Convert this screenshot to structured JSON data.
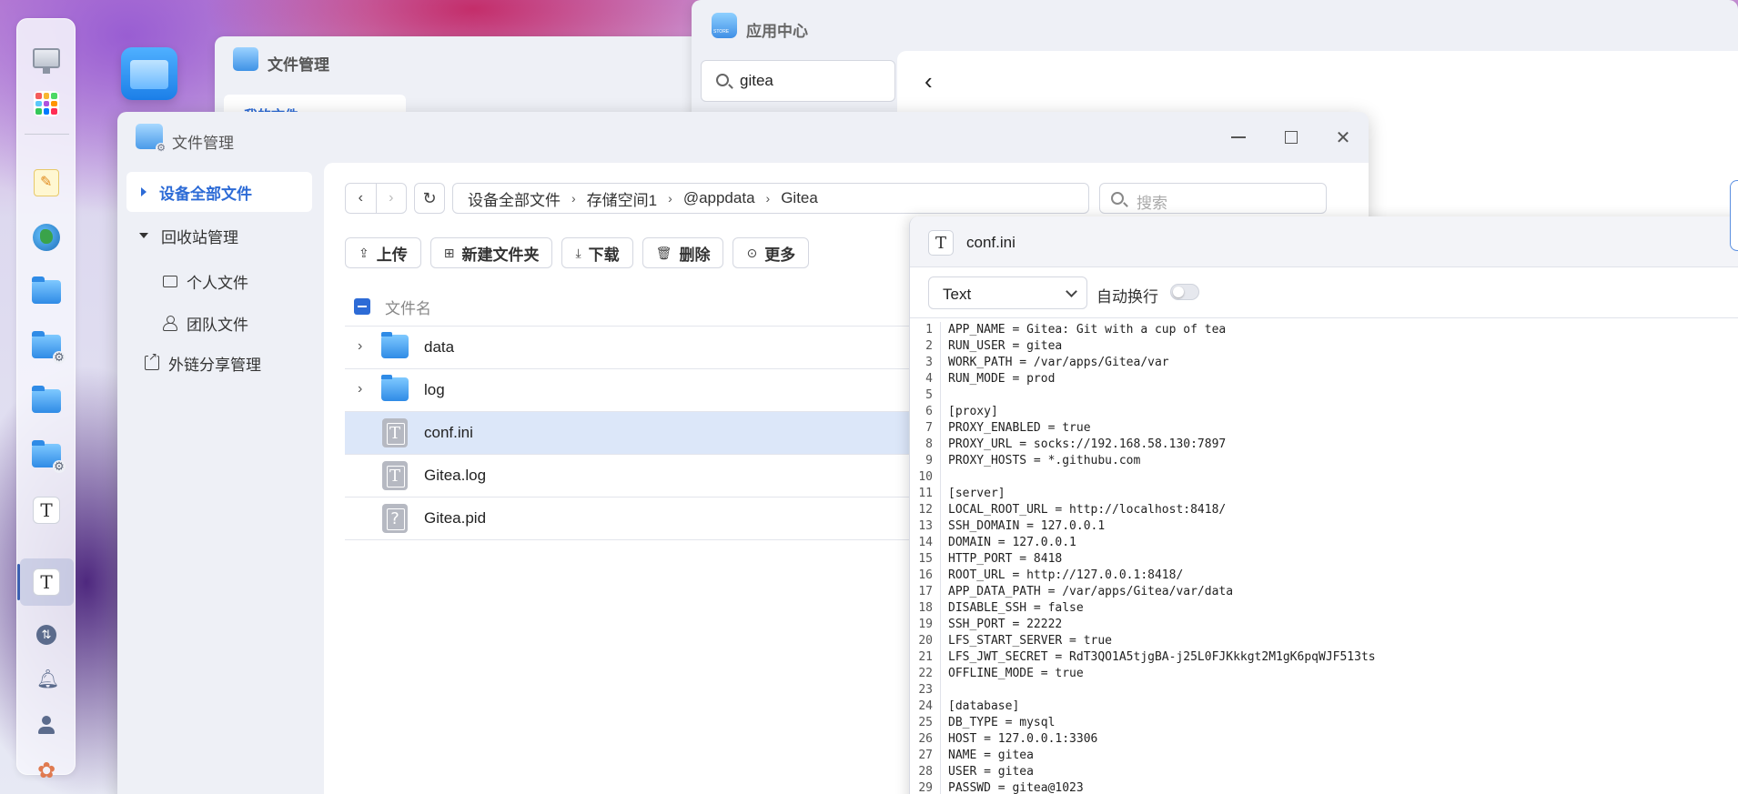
{
  "background_windows": {
    "file_manager_back": {
      "title": "文件管理",
      "sidebar_item": "我的文件"
    },
    "app_center": {
      "title": "应用中心",
      "search_value": "gitea"
    }
  },
  "file_manager": {
    "title": "文件管理",
    "sidebar": {
      "all_files": "设备全部文件",
      "recycle": "回收站管理",
      "personal": "个人文件",
      "team": "团队文件",
      "share": "外链分享管理"
    },
    "breadcrumb": [
      "设备全部文件",
      "存储空间1",
      "@appdata",
      "Gitea"
    ],
    "search_placeholder": "搜索",
    "toolbar": {
      "upload": "上传",
      "new_folder": "新建文件夹",
      "download": "下载",
      "delete": "删除",
      "more": "更多"
    },
    "list_header": "文件名",
    "files": [
      {
        "name": "data",
        "type": "folder"
      },
      {
        "name": "log",
        "type": "folder"
      },
      {
        "name": "conf.ini",
        "type": "text",
        "selected": true
      },
      {
        "name": "Gitea.log",
        "type": "text"
      },
      {
        "name": "Gitea.pid",
        "type": "unknown"
      }
    ]
  },
  "editor": {
    "file_name": "conf.ini",
    "mode": "Text",
    "wrap_label": "自动换行",
    "wrap_enabled": false,
    "lines": [
      "APP_NAME = Gitea: Git with a cup of tea",
      "RUN_USER = gitea",
      "WORK_PATH = /var/apps/Gitea/var",
      "RUN_MODE = prod",
      "",
      "[proxy]",
      "PROXY_ENABLED = true",
      "PROXY_URL = socks://192.168.58.130:7897",
      "PROXY_HOSTS = *.githubu.com",
      "",
      "[server]",
      "LOCAL_ROOT_URL = http://localhost:8418/",
      "SSH_DOMAIN = 127.0.0.1",
      "DOMAIN = 127.0.0.1",
      "HTTP_PORT = 8418",
      "ROOT_URL = http://127.0.0.1:8418/",
      "APP_DATA_PATH = /var/apps/Gitea/var/data",
      "DISABLE_SSH = false",
      "SSH_PORT = 22222",
      "LFS_START_SERVER = true",
      "LFS_JWT_SECRET = RdT3QO1A5tjgBA-j25L0FJKkkgt2M1gK6pqWJF513ts",
      "OFFLINE_MODE = true",
      "",
      "[database]",
      "DB_TYPE = mysql",
      "HOST = 127.0.0.1:3306",
      "NAME = gitea",
      "USER = gitea",
      "PASSWD = gitea@1023"
    ]
  },
  "icons": {
    "dock": [
      "monitor-icon",
      "apps-icon",
      "notes-icon",
      "globe-icon",
      "folder-icon",
      "folder-settings-icon",
      "folder-icon",
      "folder-settings-icon",
      "text-editor-icon",
      "text-editor-icon",
      "transfer-icon",
      "bell-icon",
      "user-icon",
      "settings-icon"
    ]
  },
  "colors": {
    "accent": "#2d6bd6",
    "selected_row": "#dce7f9"
  }
}
